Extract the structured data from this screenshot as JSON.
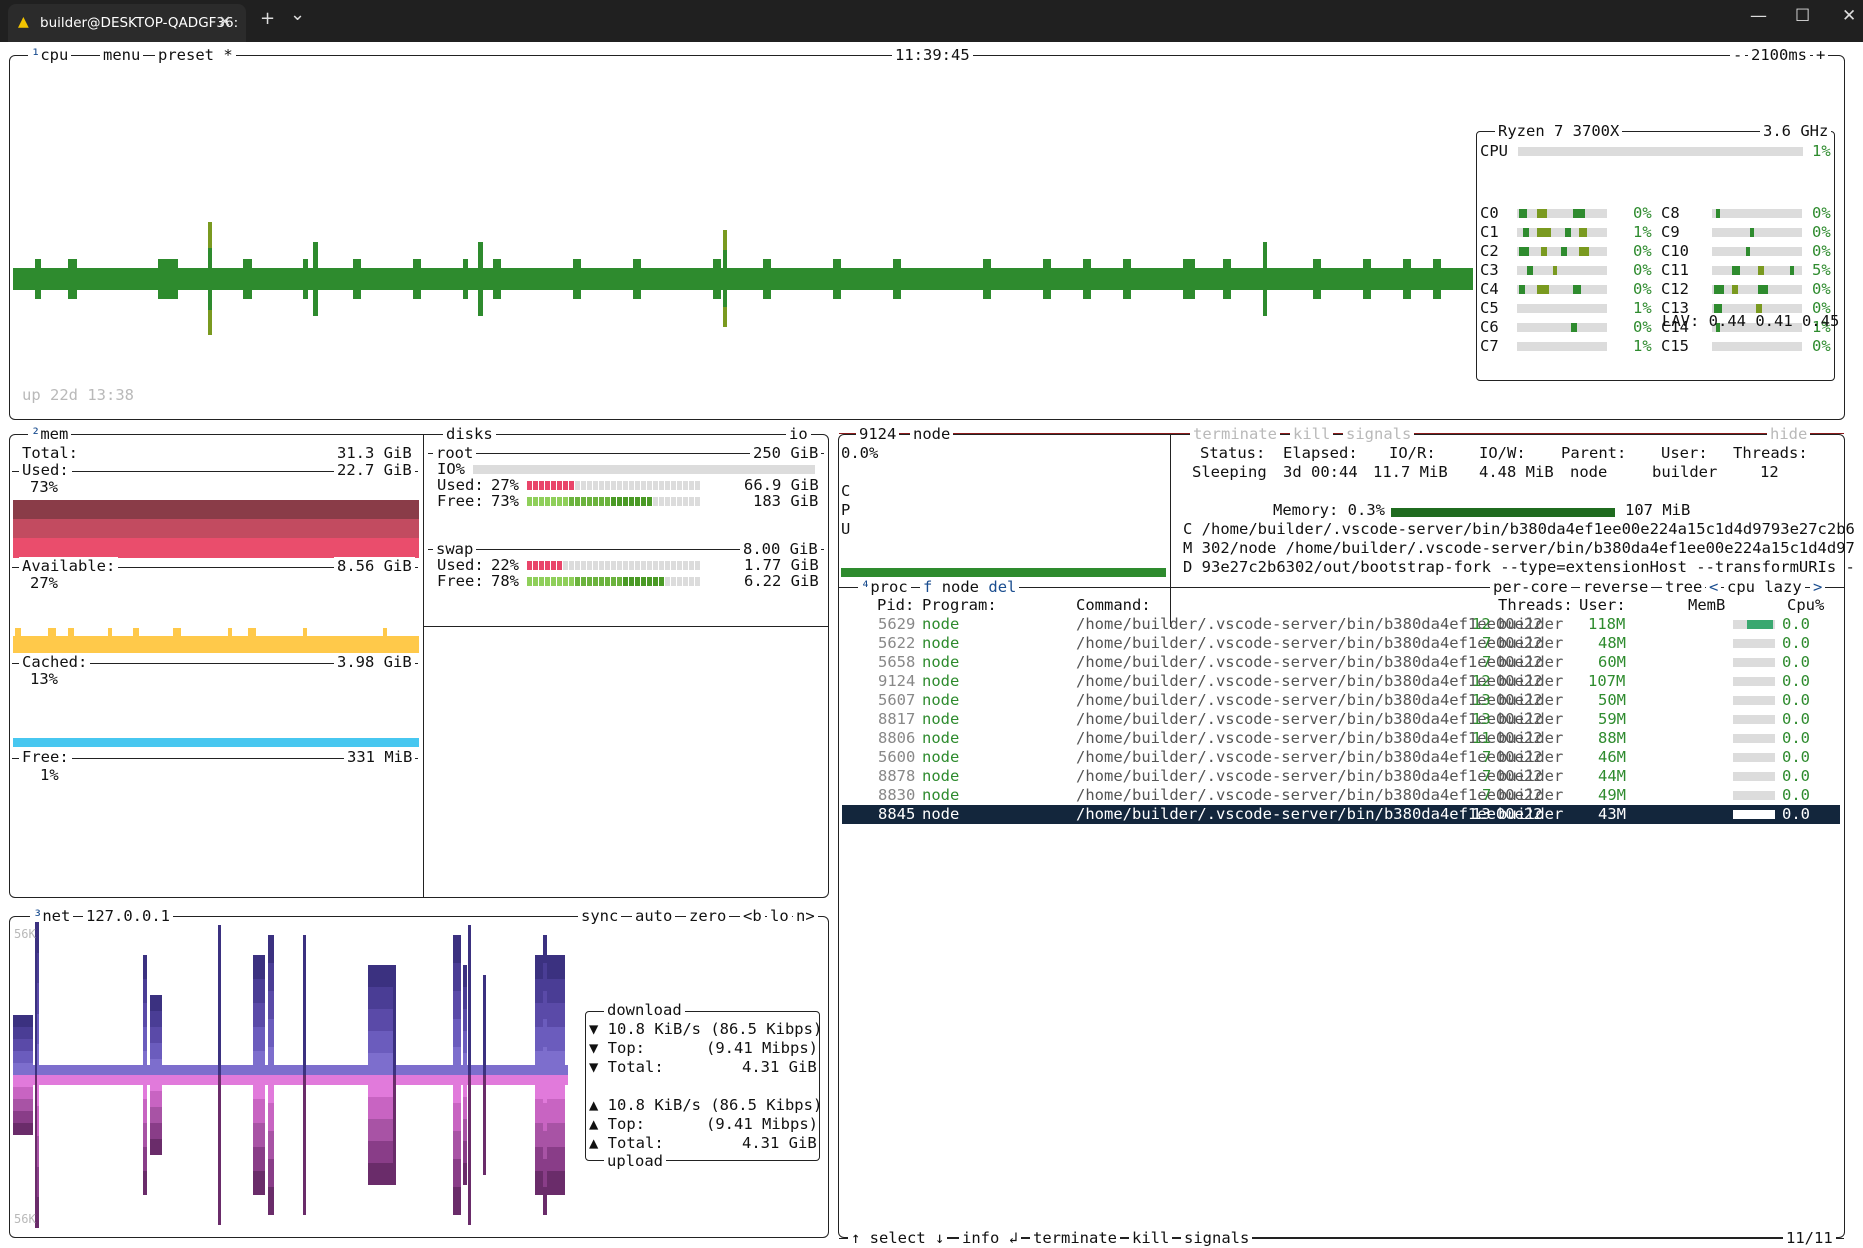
{
  "window": {
    "tab_title": "builder@DESKTOP-QADGF36:",
    "new_tab": "+",
    "dropdown": "⌄",
    "close_tab": "✕",
    "minimize": "—",
    "maximize": "☐",
    "close": "✕"
  },
  "cpu_box": {
    "label_num": "¹",
    "label": "cpu",
    "menu": "menu",
    "preset": "preset *",
    "clock": "11:39:45",
    "minus": "-",
    "interval": "2100ms",
    "plus": "+",
    "uptime": "up 22d 13:38",
    "model": "Ryzen 7 3700X",
    "freq": "3.6 GHz",
    "total_label": "CPU",
    "total_pct": "1%",
    "cores": [
      {
        "name": "C0",
        "pct": "0%"
      },
      {
        "name": "C1",
        "pct": "1%"
      },
      {
        "name": "C2",
        "pct": "0%"
      },
      {
        "name": "C3",
        "pct": "0%"
      },
      {
        "name": "C4",
        "pct": "0%"
      },
      {
        "name": "C5",
        "pct": "1%"
      },
      {
        "name": "C6",
        "pct": "0%"
      },
      {
        "name": "C7",
        "pct": "1%"
      },
      {
        "name": "C8",
        "pct": "0%"
      },
      {
        "name": "C9",
        "pct": "0%"
      },
      {
        "name": "C10",
        "pct": "0%"
      },
      {
        "name": "C11",
        "pct": "5%"
      },
      {
        "name": "C12",
        "pct": "0%"
      },
      {
        "name": "C13",
        "pct": "0%"
      },
      {
        "name": "C14",
        "pct": "1%"
      },
      {
        "name": "C15",
        "pct": "0%"
      }
    ],
    "lav": "LAV: 0.44 0.41 0.45"
  },
  "mem_box": {
    "label_num": "²",
    "label": "mem",
    "total_label": "Total:",
    "total_value": "31.3 GiB",
    "used_label": "Used:",
    "used_value": "22.7 GiB",
    "used_pct": "73%",
    "avail_label": "Available:",
    "avail_value": "8.56 GiB",
    "avail_pct": "27%",
    "cached_label": "Cached:",
    "cached_value": "3.98 GiB",
    "cached_pct": "13%",
    "free_label": "Free:",
    "free_value": "331 MiB",
    "free_pct": "1%"
  },
  "disks_box": {
    "label": "disks",
    "io": "io",
    "root_label": "root",
    "root_size": "250 GiB",
    "io_label": "IO%",
    "root_used_label": "Used:",
    "root_used_pct": "27%",
    "root_used_val": "66.9 GiB",
    "root_free_label": "Free:",
    "root_free_pct": "73%",
    "root_free_val": "183 GiB",
    "swap_label": "swap",
    "swap_size": "8.00 GiB",
    "swap_used_label": "Used:",
    "swap_used_pct": "22%",
    "swap_used_val": "1.77 GiB",
    "swap_free_label": "Free:",
    "swap_free_pct": "78%",
    "swap_free_val": "6.22 GiB"
  },
  "net_box": {
    "label_num": "³",
    "label": "net",
    "iface": "127.0.0.1",
    "sync": "sync",
    "auto": "auto",
    "zero": "zero",
    "prev": "<b",
    "lo": "lo",
    "next": "n>",
    "scale_top": "56K",
    "scale_bottom": "56K",
    "download_title": "download",
    "dl_rate": "▼ 10.8 KiB/s (86.5 Kibps)",
    "dl_top_label": "▼ Top:",
    "dl_top_val": "(9.41 Mibps)",
    "dl_total_label": "▼ Total:",
    "dl_total_val": "4.31 GiB",
    "ul_rate": "▲ 10.8 KiB/s (86.5 Kibps)",
    "ul_top_label": "▲ Top:",
    "ul_top_val": "(9.41 Mibps)",
    "ul_total_label": "▲ Total:",
    "ul_total_val": "4.31 GiB",
    "upload_title": "upload"
  },
  "detail_box": {
    "pid": "9124",
    "name": "node",
    "terminate": "terminate",
    "kill": "kill",
    "signals": "signals",
    "hide": "hide",
    "cpu_pct": "0.0%",
    "cpu_letters": [
      "C",
      "P",
      "U"
    ],
    "status_label": "Status:",
    "status": "Sleeping",
    "elapsed_label": "Elapsed:",
    "elapsed": "3d 00:44",
    "ior_label": "IO/R:",
    "ior": "11.7 MiB",
    "iow_label": "IO/W:",
    "iow": "4.48 MiB",
    "parent_label": "Parent:",
    "parent": "node",
    "user_label": "User:",
    "user": "builder",
    "threads_label": "Threads:",
    "threads": "12",
    "memory_label": "Memory: 0.3%",
    "memory_val": "107 MiB",
    "cmd_lines": [
      "C /home/builder/.vscode-server/bin/b380da4ef1ee00e224a15c1d4d9793e27c2b6",
      "M 302/node /home/builder/.vscode-server/bin/b380da4ef1ee00e224a15c1d4d97",
      "D 93e27c2b6302/out/bootstrap-fork --type=extensionHost --transformURIs -"
    ]
  },
  "proc_box": {
    "label_num": "⁴",
    "label": "proc",
    "filter_key": "f",
    "filter_text": "node",
    "del": "del",
    "per_core": "per-core",
    "reverse": "reverse",
    "tree": "tree",
    "sort_prev": "<",
    "sort": "cpu lazy",
    "sort_next": ">",
    "headers": {
      "pid": "Pid:",
      "program": "Program:",
      "command": "Command:",
      "threads": "Threads:",
      "user": "User:",
      "mem": "MemB",
      "cpu": "Cpu%"
    },
    "rows": [
      {
        "pid": "5629",
        "program": "node",
        "command": "/home/builder/.vscode-server/bin/b380da4ef1ee00e22",
        "threads": "12",
        "user": "builder",
        "mem": "118M",
        "cpu": "0.0"
      },
      {
        "pid": "5622",
        "program": "node",
        "command": "/home/builder/.vscode-server/bin/b380da4ef1ee00e22",
        "threads": "7",
        "user": "builder",
        "mem": "48M",
        "cpu": "0.0"
      },
      {
        "pid": "5658",
        "program": "node",
        "command": "/home/builder/.vscode-server/bin/b380da4ef1ee00e22",
        "threads": "7",
        "user": "builder",
        "mem": "60M",
        "cpu": "0.0"
      },
      {
        "pid": "9124",
        "program": "node",
        "command": "/home/builder/.vscode-server/bin/b380da4ef1ee00e22",
        "threads": "12",
        "user": "builder",
        "mem": "107M",
        "cpu": "0.0"
      },
      {
        "pid": "5607",
        "program": "node",
        "command": "/home/builder/.vscode-server/bin/b380da4ef1ee00e22",
        "threads": "13",
        "user": "builder",
        "mem": "50M",
        "cpu": "0.0"
      },
      {
        "pid": "8817",
        "program": "node",
        "command": "/home/builder/.vscode-server/bin/b380da4ef1ee00e22",
        "threads": "13",
        "user": "builder",
        "mem": "59M",
        "cpu": "0.0"
      },
      {
        "pid": "8806",
        "program": "node",
        "command": "/home/builder/.vscode-server/bin/b380da4ef1ee00e22",
        "threads": "11",
        "user": "builder",
        "mem": "88M",
        "cpu": "0.0"
      },
      {
        "pid": "5600",
        "program": "node",
        "command": "/home/builder/.vscode-server/bin/b380da4ef1ee00e22",
        "threads": "7",
        "user": "builder",
        "mem": "46M",
        "cpu": "0.0"
      },
      {
        "pid": "8878",
        "program": "node",
        "command": "/home/builder/.vscode-server/bin/b380da4ef1ee00e22",
        "threads": "7",
        "user": "builder",
        "mem": "44M",
        "cpu": "0.0"
      },
      {
        "pid": "8830",
        "program": "node",
        "command": "/home/builder/.vscode-server/bin/b380da4ef1ee00e22",
        "threads": "7",
        "user": "builder",
        "mem": "49M",
        "cpu": "0.0"
      },
      {
        "pid": "8845",
        "program": "node",
        "command": "/home/builder/.vscode-server/bin/b380da4ef1ee00e22",
        "threads": "13",
        "user": "builder",
        "mem": "43M",
        "cpu": "0.0"
      }
    ],
    "selected_index": 10,
    "footer_select": "↑ select ↓",
    "footer_info": "info ↲",
    "footer_terminate": "terminate",
    "footer_kill": "kill",
    "footer_signals": "signals",
    "footer_count": "11/11"
  },
  "colors": {
    "cpu_graph": "#2e8b2e",
    "used_mem": "#e9456a",
    "avail_mem": "#ffc94a",
    "cached_mem": "#47c7f0",
    "net_download": "#5a4aa8",
    "net_upload": "#b64bb0",
    "selected_row": "#13263c"
  }
}
